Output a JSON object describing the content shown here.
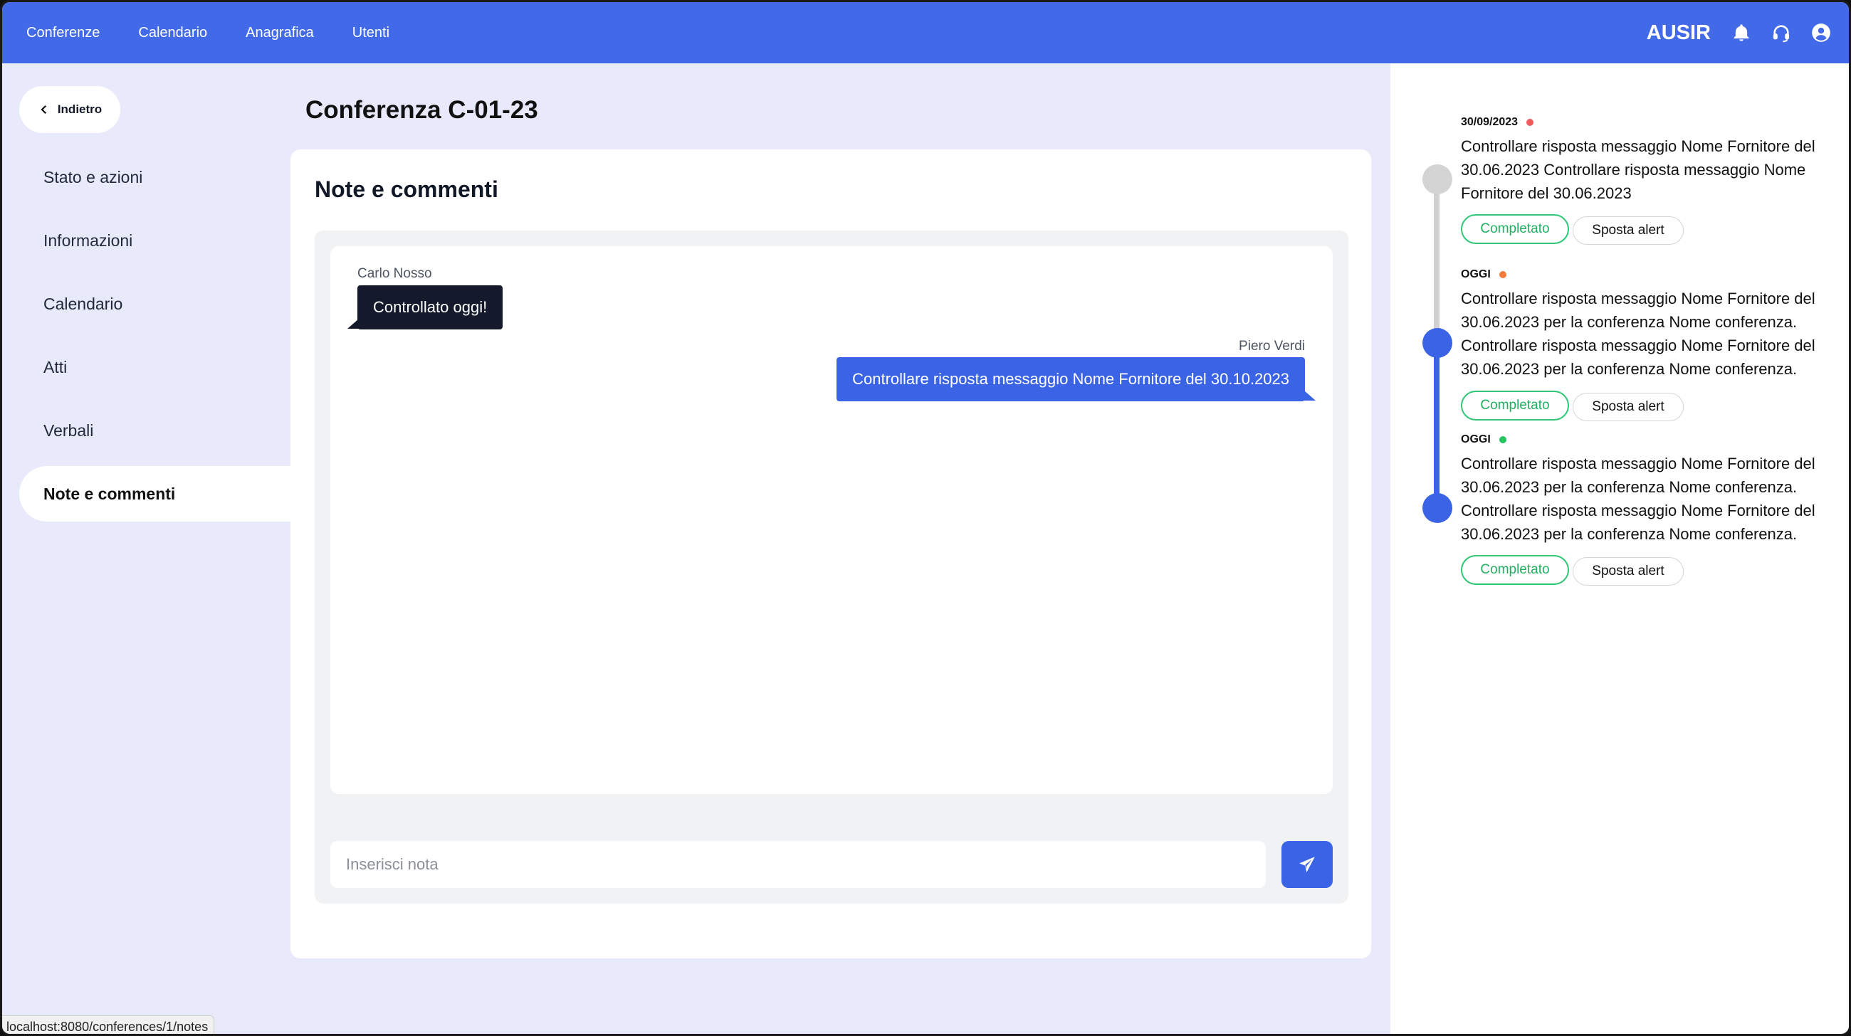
{
  "topnav": {
    "links": [
      "Conferenze",
      "Calendario",
      "Anagrafica",
      "Utenti"
    ],
    "brand": "AUSIR",
    "icons": [
      "bell-icon",
      "headset-icon",
      "user-icon"
    ]
  },
  "sidebar": {
    "back_label": "Indietro",
    "items": [
      {
        "label": "Stato e azioni"
      },
      {
        "label": "Informazioni"
      },
      {
        "label": "Calendario"
      },
      {
        "label": "Atti"
      },
      {
        "label": "Verbali"
      },
      {
        "label": "Note e commenti",
        "active": true
      }
    ]
  },
  "main": {
    "title": "Conferenza C-01-23",
    "panel_title": "Note e commenti",
    "messages": [
      {
        "author": "Carlo Nosso",
        "text": "Controllato oggi!",
        "side": "left"
      },
      {
        "author": "Piero Verdi",
        "text": "Controllare risposta messaggio Nome Fornitore del 30.10.2023",
        "side": "right"
      }
    ],
    "input_placeholder": "Inserisci nota",
    "input_value": ""
  },
  "timeline": {
    "items": [
      {
        "date": "30/09/2023",
        "status_color": "#f05a5a",
        "text": "Controllare risposta messaggio Nome Fornitore del 30.06.2023 Controllare risposta messaggio Nome Fornitore del 30.06.2023",
        "complete_label": "Completato",
        "move_label": "Sposta alert"
      },
      {
        "date": "OGGI",
        "status_color": "#f47b3a",
        "text": "Controllare risposta messaggio Nome Fornitore del 30.06.2023 per la conferenza Nome conferenza. Controllare risposta messaggio Nome Fornitore del 30.06.2023 per la conferenza Nome conferenza.",
        "complete_label": "Completato",
        "move_label": "Sposta alert"
      },
      {
        "date": "OGGI",
        "status_color": "#22c55e",
        "text": "Controllare risposta messaggio Nome Fornitore del 30.06.2023 per la conferenza Nome conferenza. Controllare risposta messaggio Nome Fornitore del 30.06.2023 per la conferenza Nome conferenza.",
        "complete_label": "Completato",
        "move_label": "Sposta alert"
      }
    ]
  },
  "statusbar": {
    "url": "localhost:8080/conferences/1/notes"
  },
  "colors": {
    "accent": "#4169e8",
    "background": "#e8eafb",
    "timeline_done": "#d1d1d1"
  }
}
